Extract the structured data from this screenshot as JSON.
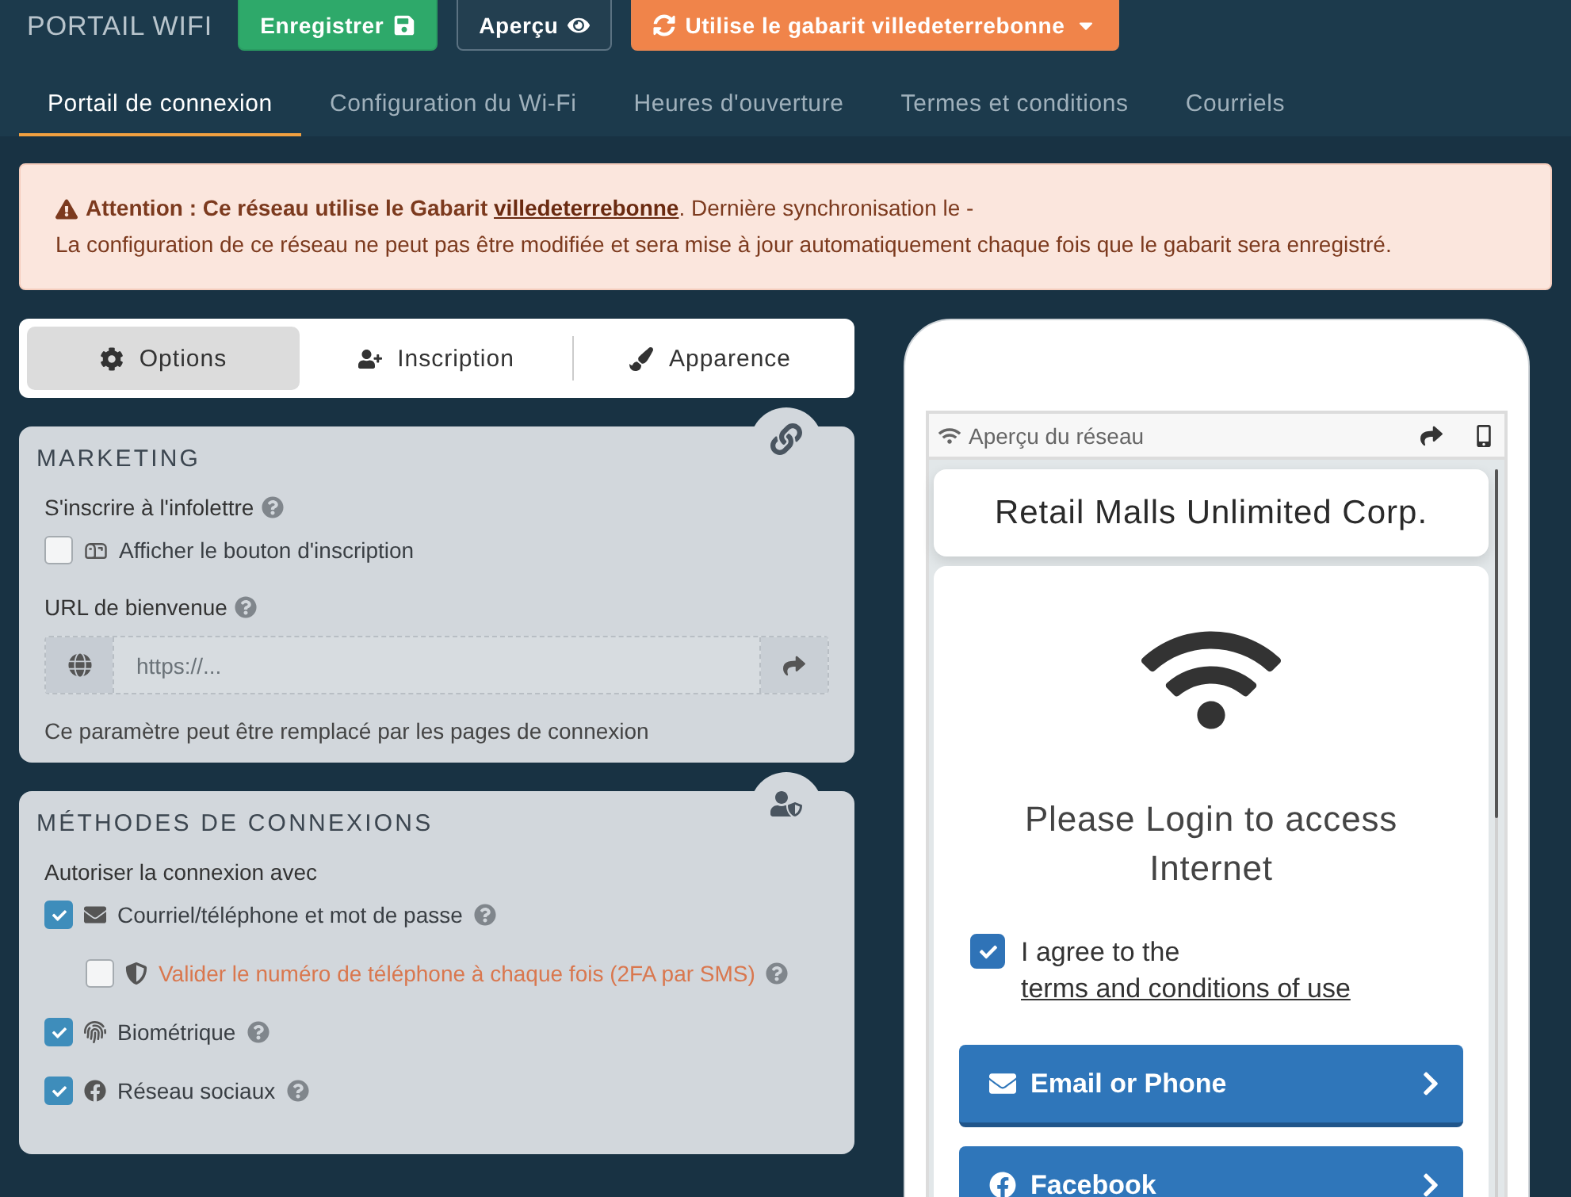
{
  "header": {
    "title": "PORTAIL WIFI",
    "buttons": [
      {
        "label": "Enregistrer",
        "kind": "save"
      },
      {
        "label": "Aperçu",
        "kind": "preview"
      },
      {
        "label": "Utilise le gabarit villedeterrebonne",
        "kind": "template"
      }
    ]
  },
  "tabs": [
    {
      "label": "Portail de connexion",
      "selected": true
    },
    {
      "label": "Configuration du Wi-Fi",
      "selected": false
    },
    {
      "label": "Heures d'ouverture",
      "selected": false
    },
    {
      "label": "Termes et conditions",
      "selected": false
    },
    {
      "label": "Courriels",
      "selected": false
    }
  ],
  "alert": {
    "prefix": "**Attention : Ce réseau utilise le Gabarit** ",
    "link": "villedeterrebonne",
    "suffix": ". Dernière synchronisation le -",
    "message": "La configuration de ce réseau ne peut pas être modifiée et sera mise à jour automatiquement chaque fois que le gabarit sera enregistré."
  },
  "segments": [
    {
      "label": "Options",
      "kind": "options",
      "selected": true
    },
    {
      "label": "Inscription",
      "kind": "signup",
      "selected": false
    },
    {
      "label": "Apparence",
      "kind": "appearance",
      "selected": false
    }
  ],
  "marketing": {
    "title": "MARKETING",
    "newsletter_label": "S'inscrire à l'infolettre",
    "checkbox": {
      "label": "Afficher le bouton d'inscription",
      "checked": false
    },
    "url_label": "URL de bienvenue",
    "url_placeholder": "https://...",
    "hint": "Ce paramètre peut être remplacé par les pages de connexion"
  },
  "methods": {
    "title": "MÉTHODES DE CONNEXIONS",
    "subtitle": "Autoriser la connexion avec",
    "options": [
      {
        "label": "Courriel/téléphone et mot de passe",
        "kind": "email",
        "checked": true,
        "children": [
          {
            "label": "Valider le numéro de téléphone à chaque fois (2FA par SMS)",
            "kind": "shield",
            "checked": false
          }
        ]
      },
      {
        "label": "Biométrique",
        "kind": "fingerprint",
        "checked": true
      },
      {
        "label": "Réseau sociaux",
        "kind": "facebook",
        "checked": true
      }
    ]
  },
  "preview": {
    "bar_title": "Aperçu du réseau",
    "brand": "Retail Malls Unlimited Corp.",
    "heading": "Please Login to access Internet",
    "agree": {
      "text": "I agree to the ",
      "link": "terms and conditions of use",
      "checked": true
    },
    "buttons": [
      {
        "label": "Email or Phone",
        "kind": "email"
      },
      {
        "label": "Facebook",
        "kind": "facebook"
      }
    ]
  }
}
